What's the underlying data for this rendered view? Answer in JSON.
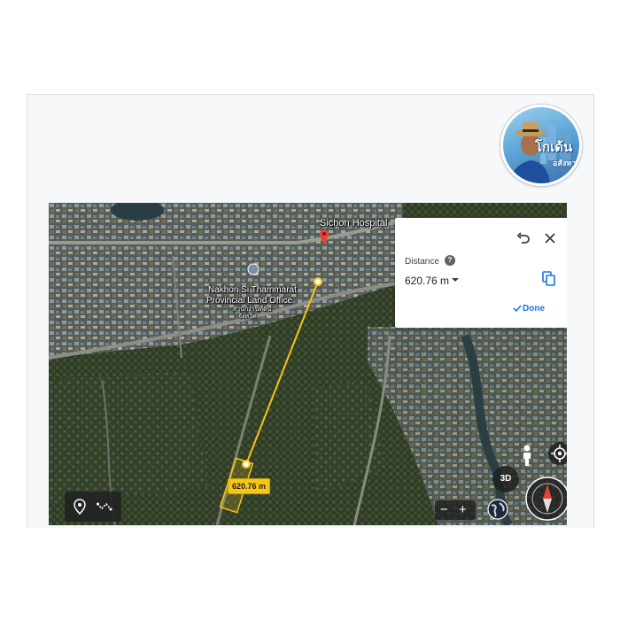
{
  "profile": {
    "name_line1": "โกเด้น",
    "name_line2": "อสังหา"
  },
  "map": {
    "labels": {
      "hospital": "Sichon Hospital",
      "office_line1": "Nakhon Si Thammarat",
      "office_line2": "Provincial Land Office",
      "office_thai_line1": "สำนักงานที่ดิน",
      "office_thai_line2": "จังหวัด"
    },
    "measurement_tag": "620.76 m"
  },
  "distance_panel": {
    "title": "Distance",
    "value": "620.76 m",
    "done_label": "Done",
    "help_glyph": "?"
  },
  "controls": {
    "threed_label": "3D",
    "zoom_out": "−",
    "zoom_in": "+"
  },
  "colors": {
    "measure_line": "#f5c518",
    "accent_blue": "#1a73e8",
    "marker_red": "#ea4335"
  },
  "icons": [
    "undo-icon",
    "close-icon",
    "help-icon",
    "copy-icon",
    "check-icon",
    "pin-icon",
    "path-icon",
    "locate-icon",
    "pegman-icon",
    "globe-icon",
    "compass-icon"
  ]
}
